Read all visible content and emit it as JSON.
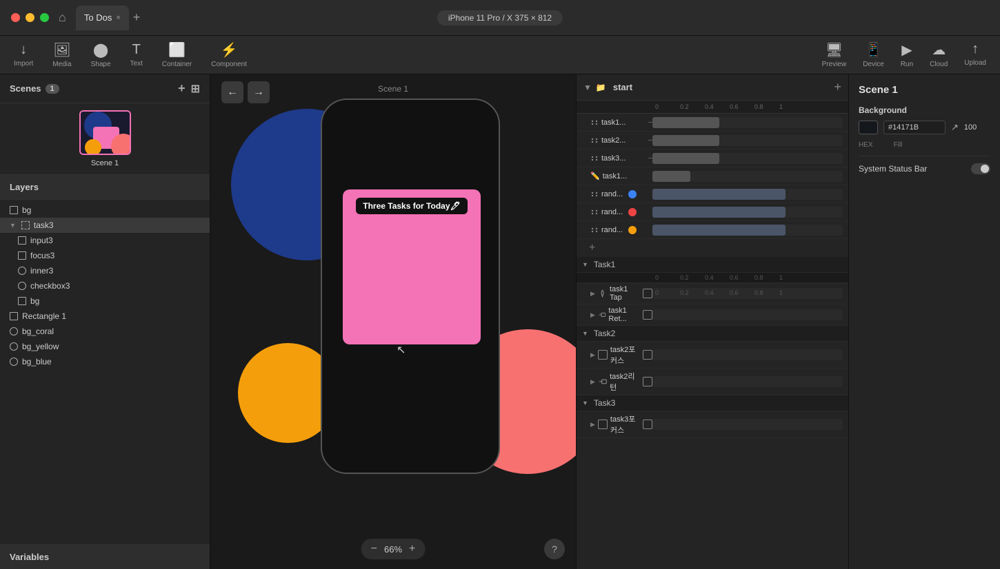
{
  "titlebar": {
    "tab_title": "To Dos",
    "close_tab": "×",
    "add_tab": "+",
    "device_label": "iPhone 11 Pro / X  375 × 812",
    "home_icon": "⌂"
  },
  "toolbar": {
    "import_label": "Import",
    "media_label": "Media",
    "shape_label": "Shape",
    "text_label": "Text",
    "container_label": "Container",
    "component_label": "Component",
    "preview_label": "Preview",
    "device_label": "Device",
    "run_label": "Run",
    "cloud_label": "Cloud",
    "upload_label": "Upload"
  },
  "left_panel": {
    "scenes_title": "Scenes",
    "scenes_count": "1",
    "scene_name": "Scene 1",
    "layers_title": "Layers",
    "layers": [
      {
        "id": "bg",
        "name": "bg",
        "type": "rect",
        "indent": 0
      },
      {
        "id": "task3",
        "name": "task3",
        "type": "rect-dashed",
        "indent": 0,
        "expanded": true
      },
      {
        "id": "input3",
        "name": "input3",
        "type": "rect",
        "indent": 1
      },
      {
        "id": "focus3",
        "name": "focus3",
        "type": "rect",
        "indent": 1
      },
      {
        "id": "inner3",
        "name": "inner3",
        "type": "circle",
        "indent": 1
      },
      {
        "id": "checkbox3",
        "name": "checkbox3",
        "type": "circle",
        "indent": 1
      },
      {
        "id": "bg2",
        "name": "bg",
        "type": "rect",
        "indent": 1
      },
      {
        "id": "rect1",
        "name": "Rectangle 1",
        "type": "rect",
        "indent": 0
      },
      {
        "id": "bg_coral",
        "name": "bg_coral",
        "type": "circle",
        "indent": 0
      },
      {
        "id": "bg_yellow",
        "name": "bg_yellow",
        "type": "circle",
        "indent": 0
      },
      {
        "id": "bg_blue",
        "name": "bg_blue",
        "type": "circle",
        "indent": 0
      }
    ],
    "variables_title": "Variables"
  },
  "canvas": {
    "scene_label": "Scene 1",
    "nav_back": "←",
    "nav_forward": "→",
    "zoom_level": "66%",
    "zoom_minus": "−",
    "zoom_plus": "+",
    "help": "?",
    "pink_card_text": "Three Tasks for Today🖊"
  },
  "timeline": {
    "expand_icon": "▼",
    "scene_name": "start",
    "add_icon": "+",
    "ruler": [
      "0",
      "0.2",
      "0.4",
      "0.6",
      "0.8",
      "1"
    ],
    "sections": [
      {
        "id": "start",
        "rows": [
          {
            "name": "task1...",
            "type": "drag",
            "track": true,
            "block_left": "0%",
            "block_width": "35%"
          },
          {
            "name": "task2...",
            "type": "drag",
            "track": true,
            "block_left": "0%",
            "block_width": "35%"
          },
          {
            "name": "task3...",
            "type": "drag",
            "track": true,
            "block_left": "0%",
            "block_width": "35%"
          },
          {
            "name": "task1...",
            "type": "pencil",
            "track": true,
            "block_left": "0%",
            "block_width": "20%"
          },
          {
            "name": "rand...",
            "dot": "blue",
            "track": true,
            "block_left": "0%",
            "block_width": "70%"
          },
          {
            "name": "rand...",
            "dot": "red",
            "track": true,
            "block_left": "0%",
            "block_width": "70%"
          },
          {
            "name": "rand...",
            "dot": "yellow",
            "track": true,
            "block_left": "0%",
            "block_width": "70%"
          }
        ]
      }
    ],
    "task_sections": [
      {
        "name": "Task1",
        "rows": [
          {
            "name": "task1 Tap",
            "frame": true,
            "track": true,
            "block_left": "0%",
            "block_width": "0%"
          },
          {
            "name": "task1 Ret...",
            "frame": true,
            "track": true,
            "block_left": "0%",
            "block_width": "0%"
          }
        ]
      },
      {
        "name": "Task2",
        "rows": [
          {
            "name": "task2포커스",
            "frame": true,
            "track": true,
            "block_left": "0%",
            "block_width": "0%"
          },
          {
            "name": "task2리턴",
            "frame": true,
            "track": true,
            "block_left": "0%",
            "block_width": "0%"
          }
        ]
      },
      {
        "name": "Task3",
        "rows": [
          {
            "name": "task3포커스",
            "frame": true,
            "track": true,
            "block_left": "0%",
            "block_width": "0%"
          }
        ]
      }
    ]
  },
  "right_panel": {
    "scene_title": "Scene 1",
    "background_label": "Background",
    "hex_label": "HEX",
    "fill_label": "Fill",
    "hex_value": "#14171B",
    "fill_value": "100",
    "arrow_icon": "↗",
    "status_bar_label": "System Status Bar"
  }
}
